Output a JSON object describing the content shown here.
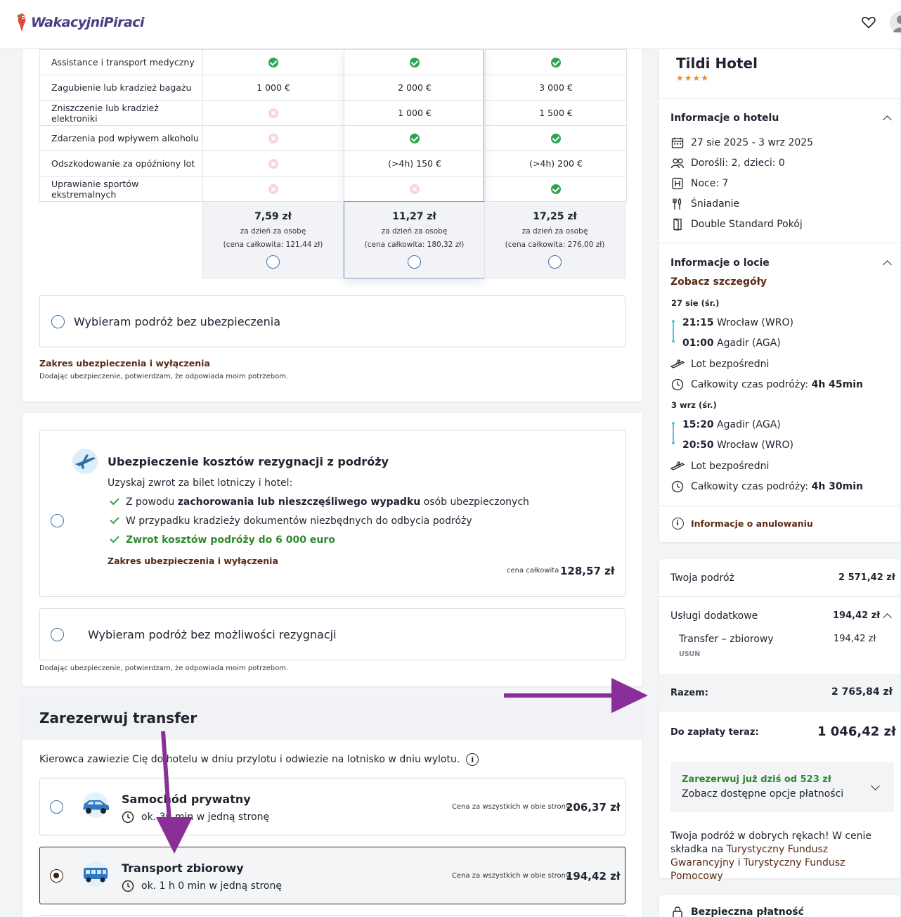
{
  "brand": {
    "name": "WakacyjniPiraci",
    "accent": "#4a3b82",
    "link_color": "#5a2a14",
    "success": "#2ea44f",
    "annotation_arrow": "#8b2f98"
  },
  "insurance_table": {
    "rows": [
      {
        "label": "Assistance i transport medyczny",
        "cells": [
          "check-icon",
          "check-icon",
          "check-icon"
        ]
      },
      {
        "label": "Zagubienie lub kradzież bagażu",
        "cells": [
          "1 000 €",
          "2 000 €",
          "3 000 €"
        ]
      },
      {
        "label": "Zniszczenie lub kradzież elektroniki",
        "cells": [
          "cross-icon",
          "1 000 €",
          "1 500 €"
        ]
      },
      {
        "label": "Zdarzenia pod wpływem alkoholu",
        "cells": [
          "cross-icon",
          "check-icon",
          "check-icon"
        ]
      },
      {
        "label": "Odszkodowanie za opóźniony lot",
        "cells": [
          "cross-icon",
          "(>4h) 150 €",
          "(>4h) 200 €"
        ]
      },
      {
        "label": "Uprawianie sportów ekstremalnych",
        "cells": [
          "cross-icon",
          "cross-icon",
          "check-icon"
        ]
      }
    ],
    "plans": [
      {
        "price": "7,59 zł",
        "per": "za dzień za osobę",
        "total": "(cena całkowita: 121,44 zł)"
      },
      {
        "price": "11,27 zł",
        "per": "za dzień za osobę",
        "total": "(cena całkowita: 180,32 zł)"
      },
      {
        "price": "17,25 zł",
        "per": "za dzień za osobę",
        "total": "(cena całkowita: 276,00 zł)"
      }
    ],
    "no_insurance_label": "Wybieram podróż bez ubezpieczenia",
    "scope_link": "Zakres ubezpieczenia i wyłączenia",
    "consent": "Dodając ubezpieczenie, potwierdzam, że odpowiada moim potrzebom."
  },
  "cancellation": {
    "title": "Ubezpieczenie kosztów rezygnacji z podróży",
    "intro": "Uzyskaj zwrot za bilet lotniczy i hotel:",
    "b1_pre": "Z powodu ",
    "b1_bold": "zachorowania lub nieszczęśliwego wypadku",
    "b1_post": " osób ubezpieczonych",
    "b2": "W przypadku kradzieży dokumentów niezbędnych do odbycia podróży",
    "b3": "Zwrot kosztów podróży do 6 000 euro",
    "scope_link": "Zakres ubezpieczenia i wyłączenia",
    "total_label": "cena całkowita",
    "total_price": "128,57 zł",
    "no_option": "Wybieram podróż bez możliwości rezygnacji",
    "consent": "Dodając ubezpieczenie, potwierdzam, że odpowiada moim potrzebom."
  },
  "transfer": {
    "title": "Zarezerwuj transfer",
    "description": "Kierowca zawiezie Cię do hotelu w dniu przylotu i odwiezie na lotnisko w dniu wylotu.",
    "options": [
      {
        "name": "Samochód prywatny",
        "time": "ok. 30 min w jedną stronę",
        "price_label": "Cena za wszystkich w obie strony",
        "price": "206,37 zł"
      },
      {
        "name": "Transport zbiorowy",
        "time": "ok. 1 h 0 min w jedną stronę",
        "price_label": "Cena za wszystkich w obie strony",
        "price": "194,42 zł"
      }
    ]
  },
  "hotel": {
    "name": "Tildi Hotel",
    "stars": "★★★★",
    "info_title": "Informacje o hotelu",
    "dates": "27 sie 2025 - 3 wrz 2025",
    "guests": "Dorośli: 2, dzieci: 0",
    "nights": "Noce: 7",
    "board": "Śniadanie",
    "room": "Double Standard Pokój"
  },
  "flight": {
    "title": "Informacje o locie",
    "details_link": "Zobacz szczegóły",
    "outbound": {
      "date": "27 sie (śr.)",
      "dep_time": "21:15",
      "dep_place": "Wrocław (WRO)",
      "arr_time": "01:00",
      "arr_place": "Agadir (AGA)",
      "type": "Lot bezpośredni",
      "duration_label": "Całkowity czas podróży:",
      "duration": "4h 45min"
    },
    "return": {
      "date": "3 wrz (śr.)",
      "dep_time": "15:20",
      "dep_place": "Agadir (AGA)",
      "arr_time": "20:50",
      "arr_place": "Wrocław (WRO)",
      "type": "Lot bezpośredni",
      "duration_label": "Całkowity czas podróży:",
      "duration": "4h 30min"
    },
    "cancel_info": "Informacje o anulowaniu"
  },
  "summary": {
    "trip_label": "Twoja podróż",
    "trip_price": "2 571,42 zł",
    "extras_label": "Usługi dodatkowe",
    "extras_price": "194,42 zł",
    "extra_item": "Transfer – zbiorowy",
    "extra_item_price": "194,42 zł",
    "remove": "USUŃ",
    "total_label": "Razem:",
    "total_price": "2 765,84 zł",
    "pay_now_label": "Do zapłaty teraz:",
    "pay_now_price": "1 046,42 zł",
    "book_today": "Zarezerwuj już dziś od 523 zł",
    "payment_options": "Zobacz dostępne opcje płatności",
    "trust_pre": "Twoja podróż w dobrych rękach! W cenie składka na ",
    "trust_link1": "Turystyczny Fundusz Gwarancyjny",
    "trust_mid": " i ",
    "trust_link2": "Turystyczny Fundusz Pomocowy",
    "secure": "Bezpieczna płatność"
  }
}
